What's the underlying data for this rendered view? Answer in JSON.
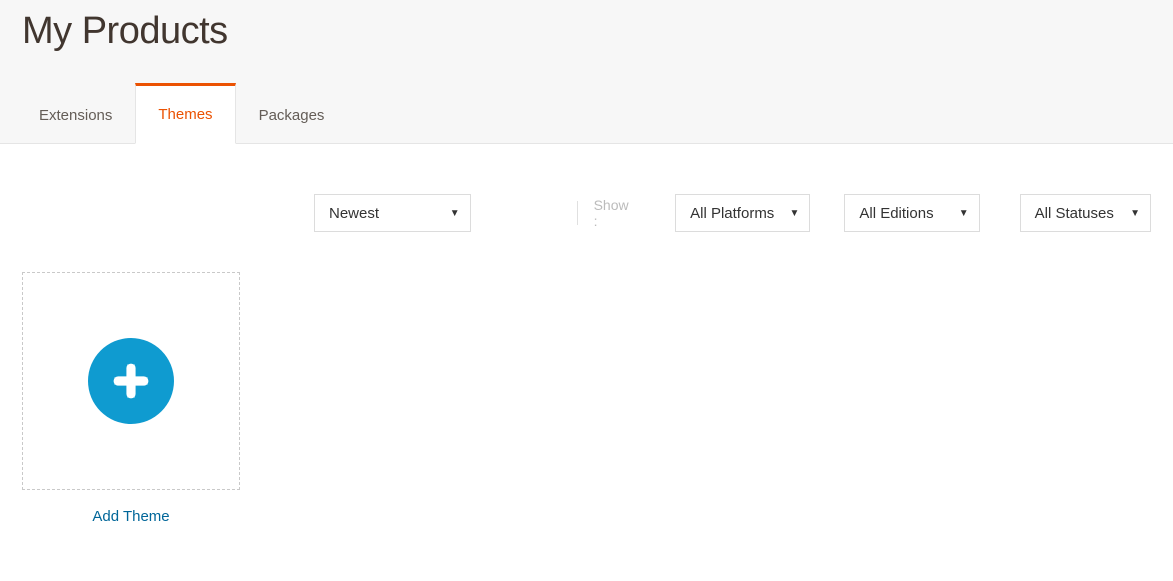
{
  "page": {
    "title": "My Products"
  },
  "tabs": [
    {
      "label": "Extensions",
      "active": false
    },
    {
      "label": "Themes",
      "active": true
    },
    {
      "label": "Packages",
      "active": false
    }
  ],
  "filters": {
    "sort": {
      "value": "Newest"
    },
    "show_label": "Show :",
    "platform": {
      "value": "All Platforms"
    },
    "edition": {
      "value": "All Editions"
    },
    "status": {
      "value": "All Statuses"
    }
  },
  "add_card": {
    "caption": "Add Theme"
  }
}
